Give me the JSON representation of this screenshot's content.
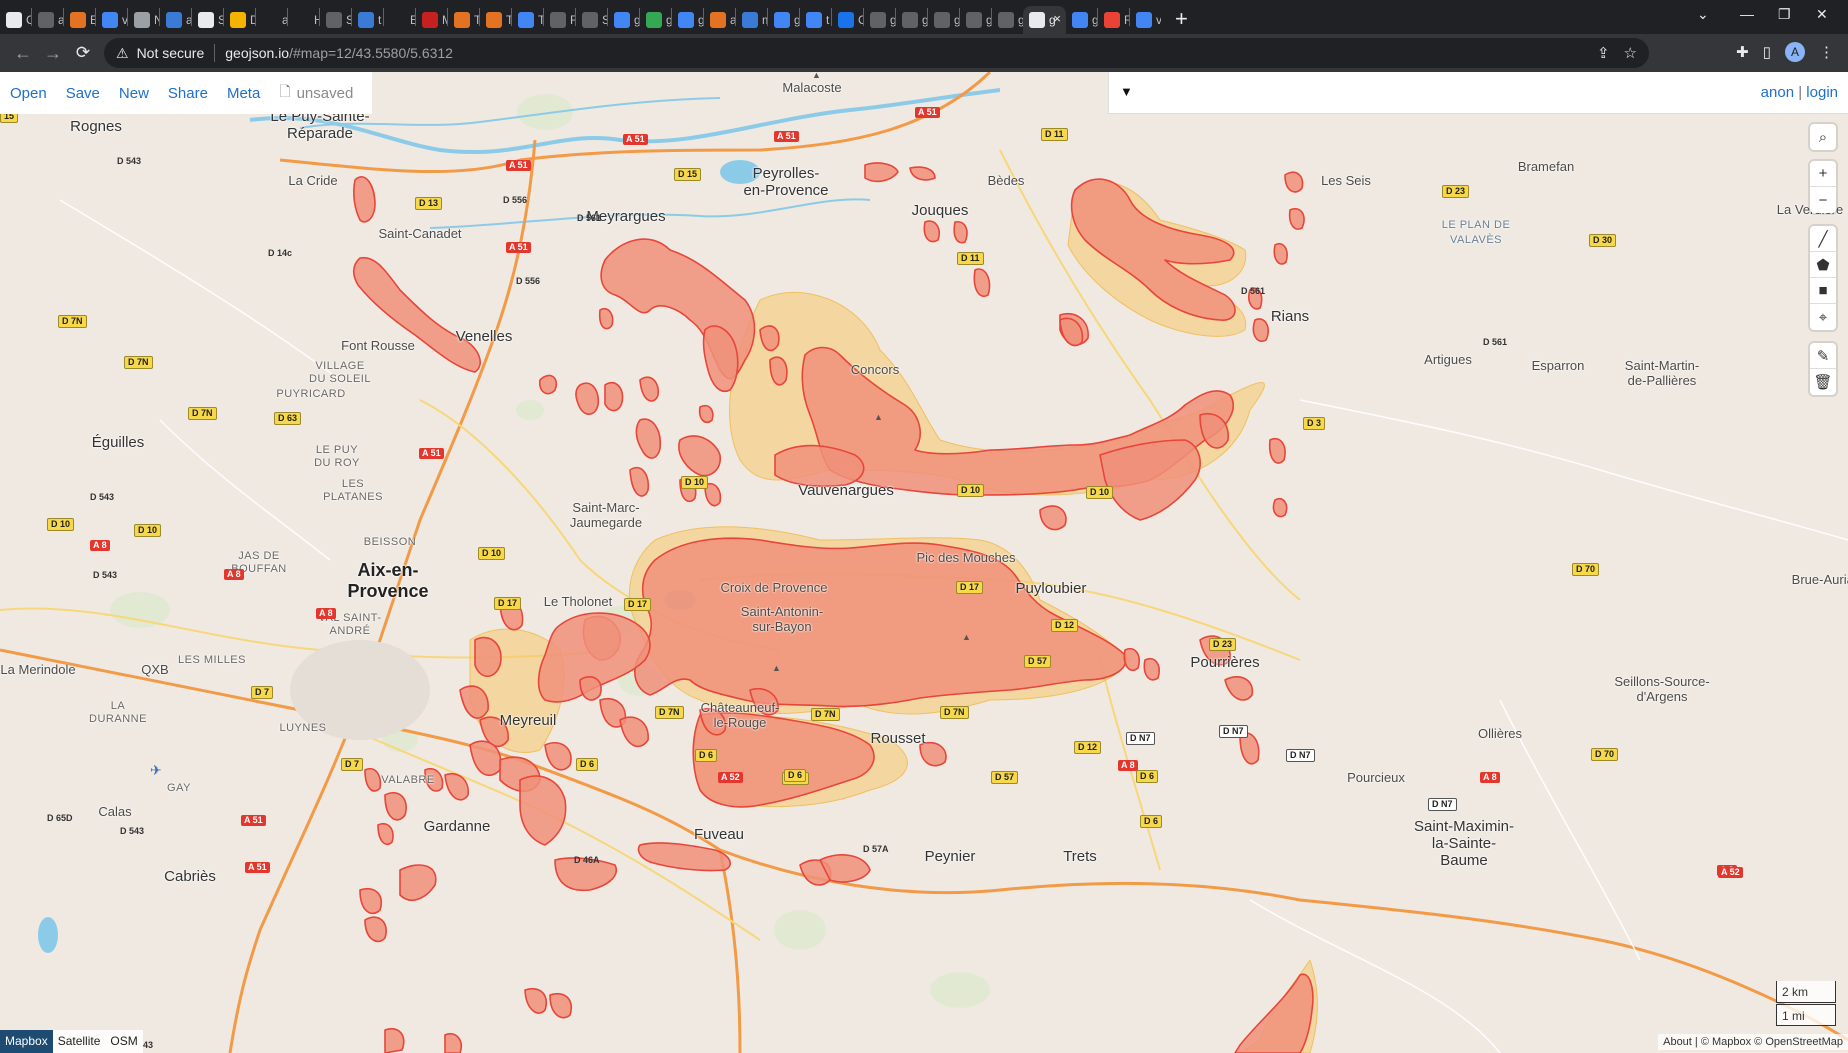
{
  "browser": {
    "tabs": [
      {
        "title": "C",
        "color": "#e8eaed"
      },
      {
        "title": "a",
        "color": "#5f6368"
      },
      {
        "title": "E",
        "color": "#e37222"
      },
      {
        "title": "v",
        "color": "#4285f4"
      },
      {
        "title": "N",
        "color": "#9aa0a6"
      },
      {
        "title": "a",
        "color": "#3a7bd5"
      },
      {
        "title": "S",
        "color": "#e8eaed"
      },
      {
        "title": "D",
        "color": "#f4b400"
      },
      {
        "title": "a",
        "color": "#202124"
      },
      {
        "title": "H",
        "color": "#202124"
      },
      {
        "title": "S",
        "color": "#5f6368"
      },
      {
        "title": "t",
        "color": "#3a7bd5"
      },
      {
        "title": "E",
        "color": "#202124"
      },
      {
        "title": "M",
        "color": "#c5221f"
      },
      {
        "title": "T",
        "color": "#e37222"
      },
      {
        "title": "T",
        "color": "#e37222"
      },
      {
        "title": "T",
        "color": "#4285f4"
      },
      {
        "title": "F",
        "color": "#5f6368"
      },
      {
        "title": "S",
        "color": "#5f6368"
      },
      {
        "title": "g",
        "color": "#4285f4"
      },
      {
        "title": "g",
        "color": "#34a853"
      },
      {
        "title": "g",
        "color": "#4285f4"
      },
      {
        "title": "a",
        "color": "#e37222"
      },
      {
        "title": "m",
        "color": "#3a7bd5"
      },
      {
        "title": "g",
        "color": "#4285f4"
      },
      {
        "title": "t",
        "color": "#4285f4"
      },
      {
        "title": "C",
        "color": "#1a73e8"
      },
      {
        "title": "g",
        "color": "#5f6368"
      },
      {
        "title": "g",
        "color": "#5f6368"
      },
      {
        "title": "g",
        "color": "#5f6368"
      },
      {
        "title": "g",
        "color": "#5f6368"
      },
      {
        "title": "g",
        "color": "#5f6368"
      },
      {
        "title": "g",
        "color": "#e8eaed",
        "active": true
      },
      {
        "title": "g",
        "color": "#4285f4"
      },
      {
        "title": "F",
        "color": "#ea4335"
      },
      {
        "title": "v",
        "color": "#4285f4"
      }
    ],
    "new_tab": "+",
    "close_tab": "×",
    "address": {
      "security": "Not secure",
      "host": "geojson.io",
      "path": "/#map=12/43.5580/5.6312"
    },
    "avatar_letter": "A"
  },
  "geojson": {
    "menu": [
      "Open",
      "Save",
      "New",
      "Share",
      "Meta"
    ],
    "status": "unsaved",
    "user": {
      "anon": "anon",
      "sep": "|",
      "login": "login"
    },
    "controls": {
      "search": "⌕",
      "zoom_in": "+",
      "zoom_out": "−",
      "draw_line": "╱",
      "draw_polygon": "⬟",
      "draw_rectangle": "■",
      "draw_marker": "⌖",
      "edit": "✎",
      "delete": "🗑"
    },
    "scale": {
      "metric": "2 km",
      "imperial": "1 mi"
    },
    "layers": [
      "Mapbox",
      "Satellite",
      "OSM"
    ],
    "active_layer": "Mapbox",
    "attribution": "About | © Mapbox © OpenStreetMap",
    "colors": {
      "fill": "#f0907a",
      "stroke": "#e8463a",
      "halo": "#f5c66a",
      "link": "#1f6fcc"
    }
  },
  "places": [
    {
      "name": "Malacoste",
      "cls": ""
    },
    {
      "name": "Rognes",
      "cls": "mid"
    },
    {
      "name": "Le Puy-Sainte-\nRéparade",
      "cls": "mid"
    },
    {
      "name": "La Cride",
      "cls": ""
    },
    {
      "name": "Peyrolles-\nen-Provence",
      "cls": "mid"
    },
    {
      "name": "Bèdes",
      "cls": ""
    },
    {
      "name": "Les Seis",
      "cls": ""
    },
    {
      "name": "Bramefan",
      "cls": ""
    },
    {
      "name": "La Verdière",
      "cls": ""
    },
    {
      "name": "Meyrargues",
      "cls": "mid"
    },
    {
      "name": "Jouques",
      "cls": "mid"
    },
    {
      "name": "Saint-Canadet",
      "cls": ""
    },
    {
      "name": "LE PLAN DE\nVALAVÈS",
      "cls": "blue"
    },
    {
      "name": "Venelles",
      "cls": "mid"
    },
    {
      "name": "Font Rousse",
      "cls": ""
    },
    {
      "name": "Rians",
      "cls": "mid"
    },
    {
      "name": "Artigues",
      "cls": ""
    },
    {
      "name": "Esparron",
      "cls": ""
    },
    {
      "name": "Saint-Martin-\nde-Pallières",
      "cls": ""
    },
    {
      "name": "VILLAGE\nDU SOLEIL",
      "cls": "small"
    },
    {
      "name": "PUYRICARD",
      "cls": "small"
    },
    {
      "name": "Concors",
      "cls": ""
    },
    {
      "name": "Éguilles",
      "cls": "mid"
    },
    {
      "name": "LE PUY\nDU ROY",
      "cls": "small"
    },
    {
      "name": "LES\nPLATANES",
      "cls": "small"
    },
    {
      "name": "Vauvenargues",
      "cls": "mid"
    },
    {
      "name": "Saint-Marc-\nJaumegarde",
      "cls": ""
    },
    {
      "name": "BEISSON",
      "cls": "small"
    },
    {
      "name": "JAS DE\nBOUFFAN",
      "cls": "small"
    },
    {
      "name": "Aix-en-\nProvence",
      "cls": "big"
    },
    {
      "name": "Pic des Mouches",
      "cls": ""
    },
    {
      "name": "Croix de Provence",
      "cls": ""
    },
    {
      "name": "Puyloubier",
      "cls": "mid"
    },
    {
      "name": "Brue-Auriac",
      "cls": ""
    },
    {
      "name": "Le Tholonet",
      "cls": ""
    },
    {
      "name": "VAL SAINT-\nANDRÉ",
      "cls": "small"
    },
    {
      "name": "Saint-Antonin-\nsur-Bayon",
      "cls": ""
    },
    {
      "name": "La Merindole",
      "cls": ""
    },
    {
      "name": "QXB",
      "cls": ""
    },
    {
      "name": "LES MILLES",
      "cls": "small"
    },
    {
      "name": "Pourrières",
      "cls": "mid"
    },
    {
      "name": "Seillons-Source-\nd'Argens",
      "cls": ""
    },
    {
      "name": "LA\nDURANNE",
      "cls": "small"
    },
    {
      "name": "LUYNES",
      "cls": "small"
    },
    {
      "name": "Meyreuil",
      "cls": "mid"
    },
    {
      "name": "Châteauneuf-\nle-Rouge",
      "cls": ""
    },
    {
      "name": "Rousset",
      "cls": "mid"
    },
    {
      "name": "Ollières",
      "cls": ""
    },
    {
      "name": "VALABRE",
      "cls": "small"
    },
    {
      "name": "GAY",
      "cls": "small"
    },
    {
      "name": "Pourcieux",
      "cls": ""
    },
    {
      "name": "Calas",
      "cls": ""
    },
    {
      "name": "Gardanne",
      "cls": "mid"
    },
    {
      "name": "Fuveau",
      "cls": "mid"
    },
    {
      "name": "Peynier",
      "cls": "mid"
    },
    {
      "name": "Trets",
      "cls": "mid"
    },
    {
      "name": "Saint-Maximin-\nla-Sainte-\nBaume",
      "cls": "mid"
    },
    {
      "name": "Cabriès",
      "cls": "mid"
    }
  ],
  "roads": [
    {
      "label": "A 51",
      "kind": "a"
    },
    {
      "label": "A 51",
      "kind": "a"
    },
    {
      "label": "A 51",
      "kind": "a"
    },
    {
      "label": "A 51",
      "kind": "a"
    },
    {
      "label": "A 51",
      "kind": "a"
    },
    {
      "label": "A 51",
      "kind": "a"
    },
    {
      "label": "A 51",
      "kind": "a"
    },
    {
      "label": "A 8",
      "kind": "a"
    },
    {
      "label": "A 8",
      "kind": "a"
    },
    {
      "label": "A 8",
      "kind": "a"
    },
    {
      "label": "A 8",
      "kind": "a"
    },
    {
      "label": "A 8",
      "kind": "a"
    },
    {
      "label": "A 8",
      "kind": "a"
    },
    {
      "label": "A 52",
      "kind": "a"
    },
    {
      "label": "A 52",
      "kind": "a"
    },
    {
      "label": "A 51",
      "kind": "a"
    },
    {
      "label": "D 11",
      "kind": "d"
    },
    {
      "label": "D 11",
      "kind": "d"
    },
    {
      "label": "D 15",
      "kind": "d"
    },
    {
      "label": "D 13",
      "kind": "d"
    },
    {
      "label": "D 23",
      "kind": "d"
    },
    {
      "label": "D 30",
      "kind": "d"
    },
    {
      "label": "D 7N",
      "kind": "d"
    },
    {
      "label": "D 7N",
      "kind": "d"
    },
    {
      "label": "D 7N",
      "kind": "d"
    },
    {
      "label": "D 63",
      "kind": "d"
    },
    {
      "label": "D 3",
      "kind": "d"
    },
    {
      "label": "D 10",
      "kind": "d"
    },
    {
      "label": "D 10",
      "kind": "d"
    },
    {
      "label": "D 10",
      "kind": "d"
    },
    {
      "label": "D 10",
      "kind": "d"
    },
    {
      "label": "D 10",
      "kind": "d"
    },
    {
      "label": "D 10",
      "kind": "d"
    },
    {
      "label": "D 17",
      "kind": "d"
    },
    {
      "label": "D 17",
      "kind": "d"
    },
    {
      "label": "D 17",
      "kind": "d"
    },
    {
      "label": "D 70",
      "kind": "d"
    },
    {
      "label": "D 12",
      "kind": "d"
    },
    {
      "label": "D 57",
      "kind": "d"
    },
    {
      "label": "D 23",
      "kind": "d"
    },
    {
      "label": "D 7",
      "kind": "d"
    },
    {
      "label": "D 7N",
      "kind": "d"
    },
    {
      "label": "D 7N",
      "kind": "d"
    },
    {
      "label": "D 7N",
      "kind": "d"
    },
    {
      "label": "D 6",
      "kind": "d"
    },
    {
      "label": "D 6",
      "kind": "d"
    },
    {
      "label": "D 96",
      "kind": "d"
    },
    {
      "label": "D 6",
      "kind": "d"
    },
    {
      "label": "D 12",
      "kind": "d"
    },
    {
      "label": "D 57",
      "kind": "d"
    },
    {
      "label": "D 6",
      "kind": "d"
    },
    {
      "label": "D 6",
      "kind": "d"
    },
    {
      "label": "D 70",
      "kind": "d"
    },
    {
      "label": "D 7",
      "kind": "d"
    },
    {
      "label": "D N7",
      "kind": "d-white"
    },
    {
      "label": "D N7",
      "kind": "d-white"
    },
    {
      "label": "D N7",
      "kind": "d-white"
    },
    {
      "label": "D N7",
      "kind": "d-white"
    },
    {
      "label": "D 543",
      "kind": "plain"
    },
    {
      "label": "D 561",
      "kind": "plain"
    },
    {
      "label": "D 556",
      "kind": "plain"
    },
    {
      "label": "D 14c",
      "kind": "plain"
    },
    {
      "label": "D 556",
      "kind": "plain"
    },
    {
      "label": "D 561",
      "kind": "plain"
    },
    {
      "label": "D 561",
      "kind": "plain"
    },
    {
      "label": "D 543",
      "kind": "plain"
    },
    {
      "label": "D 543",
      "kind": "plain"
    },
    {
      "label": "D 65D",
      "kind": "plain"
    },
    {
      "label": "D 543",
      "kind": "plain"
    },
    {
      "label": "D 46A",
      "kind": "plain"
    },
    {
      "label": "D 57A",
      "kind": "plain"
    },
    {
      "label": "15",
      "kind": "d"
    },
    {
      "label": "43",
      "kind": "plain"
    }
  ]
}
